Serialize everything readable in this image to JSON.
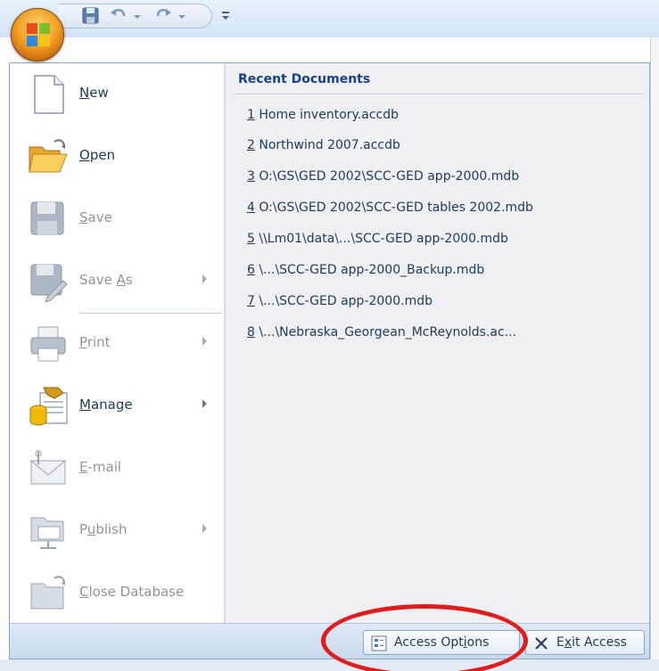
{
  "menu": {
    "items": [
      {
        "id": "new",
        "pre": "",
        "ul": "N",
        "post": "ew",
        "enabled": true,
        "submenu": false,
        "icon": "new-document-icon"
      },
      {
        "id": "open",
        "pre": "",
        "ul": "O",
        "post": "pen",
        "enabled": true,
        "submenu": false,
        "icon": "open-folder-icon"
      },
      {
        "id": "save",
        "pre": "",
        "ul": "S",
        "post": "ave",
        "enabled": false,
        "submenu": false,
        "icon": "save-disk-icon"
      },
      {
        "id": "save-as",
        "pre": "Save ",
        "ul": "A",
        "post": "s",
        "enabled": false,
        "submenu": true,
        "icon": "save-as-icon"
      },
      {
        "id": "print",
        "pre": "",
        "ul": "P",
        "post": "rint",
        "enabled": false,
        "submenu": true,
        "icon": "printer-icon"
      },
      {
        "id": "manage",
        "pre": "",
        "ul": "M",
        "post": "anage",
        "enabled": true,
        "submenu": true,
        "icon": "manage-database-icon"
      },
      {
        "id": "email",
        "pre": "",
        "ul": "E",
        "post": "-mail",
        "enabled": false,
        "submenu": false,
        "icon": "email-icon"
      },
      {
        "id": "publish",
        "pre": "P",
        "ul": "u",
        "post": "blish",
        "enabled": false,
        "submenu": true,
        "icon": "publish-icon"
      },
      {
        "id": "close-database",
        "pre": "",
        "ul": "C",
        "post": "lose Database",
        "enabled": false,
        "submenu": false,
        "icon": "close-database-icon"
      }
    ]
  },
  "recent": {
    "title": "Recent Documents",
    "items": [
      {
        "num": "1",
        "name": "Home inventory.accdb"
      },
      {
        "num": "2",
        "name": "Northwind 2007.accdb"
      },
      {
        "num": "3",
        "name": "O:\\GS\\GED 2002\\SCC-GED app-2000.mdb"
      },
      {
        "num": "4",
        "name": "O:\\GS\\GED 2002\\SCC-GED tables 2002.mdb"
      },
      {
        "num": "5",
        "name": "\\\\Lm01\\data\\...\\SCC-GED app-2000.mdb"
      },
      {
        "num": "6",
        "name": "\\...\\SCC-GED app-2000_Backup.mdb"
      },
      {
        "num": "7",
        "name": "\\...\\SCC-GED app-2000.mdb"
      },
      {
        "num": "8",
        "name": "\\...\\Nebraska_Georgean_McReynolds.ac..."
      }
    ]
  },
  "bottom": {
    "options": {
      "pre": "Access Opt",
      "ul": "i",
      "post": "ons",
      "icon": "options-icon"
    },
    "exit": {
      "pre": "E",
      "ul": "x",
      "post": "it Access",
      "icon": "close-x-icon"
    }
  },
  "colors": {
    "highlight": "#e21b1b",
    "accent": "#15428b",
    "office_orange": "#f4a326"
  }
}
